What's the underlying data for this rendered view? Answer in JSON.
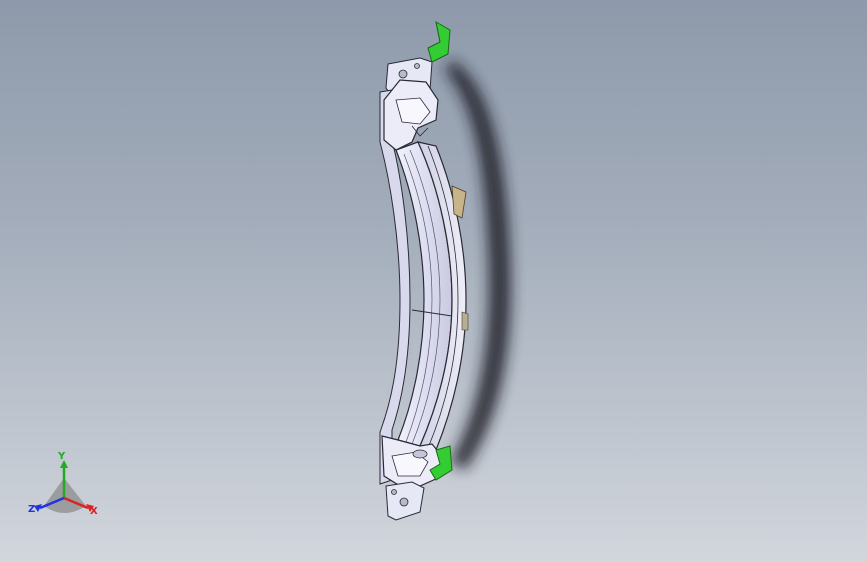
{
  "viewport": {
    "background_top": "#8e9aab",
    "background_bottom": "#d2d6dd",
    "model_color": "#e4e5f6",
    "edge_color": "#2a2a35",
    "highlight_color": "#33cc33",
    "shadow_color": "#1c1f28"
  },
  "triad": {
    "x_label": "X",
    "y_label": "Y",
    "z_label": "Z",
    "x_color": "#dd2222",
    "y_color": "#22aa22",
    "z_color": "#2233dd"
  }
}
